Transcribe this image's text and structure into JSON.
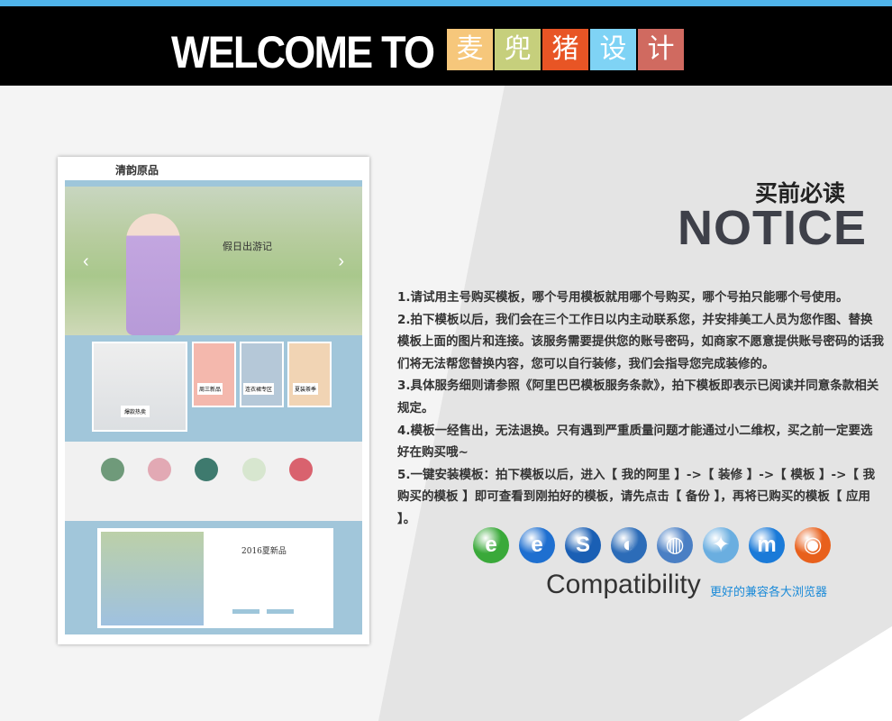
{
  "header": {
    "welcome": "WELCOME TO",
    "brand_tiles": [
      {
        "char": "麦",
        "color": "#f6c77b"
      },
      {
        "char": "兜",
        "color": "#c6cf7c"
      },
      {
        "char": "猪",
        "color": "#e85525"
      },
      {
        "char": "设",
        "color": "#7fd3f5"
      },
      {
        "char": "计",
        "color": "#d06a60"
      }
    ]
  },
  "accent_color": "#4fb3ea",
  "mockup": {
    "brand": "清韵原品",
    "hero_title": "假日出游记",
    "tiles": [
      "周三新品",
      "连衣裙专区",
      "夏装茶季",
      "爆款热卖"
    ],
    "promo_title": "2016夏新品"
  },
  "notice": {
    "title_cn": "买前必读",
    "title_en": "NOTICE",
    "rules": [
      "1.请试用主号购买模板，哪个号用模板就用哪个号购买，哪个号拍只能哪个号使用。",
      "2.拍下模板以后，我们会在三个工作日以内主动联系您，并安排美工人员为您作图、替换模板上面的图片和连接。该服务需要提供您的账号密码，如商家不愿意提供账号密码的话我们将无法帮您替换内容，您可以自行装修，我们会指导您完成装修的。",
      "3.具体服务细则请参照《阿里巴巴模板服务条款》，拍下模板即表示已阅读并同意条款相关规定。",
      "4.模板一经售出，无法退换。只有遇到严重质量问题才能通过小二维权，买之前一定要选好在购买哦~",
      "5.一键安装模板：拍下模板以后，进入【 我的阿里 】->【 装修 】->【 模板 】->【 我购买的模板 】即可查看到刚拍好的模板，请先点击【 备份 】，再将已购买的模板【 应用 】。"
    ]
  },
  "compatibility": {
    "title": "Compatibility",
    "subtitle": "更好的兼容各大浏览器",
    "browsers": [
      {
        "icon": "ie-green-icon",
        "glyph": "e",
        "color": "#3aa93a"
      },
      {
        "icon": "internet-explorer-icon",
        "glyph": "e",
        "color": "#1e6fd0"
      },
      {
        "icon": "sogou-browser-icon",
        "glyph": "S",
        "color": "#1a5fb4"
      },
      {
        "icon": "browser-globe-orange-icon",
        "glyph": "◐",
        "color": "#2c6cb8"
      },
      {
        "icon": "globe-icon",
        "glyph": "◍",
        "color": "#4a7fc4"
      },
      {
        "icon": "safari-icon",
        "glyph": "✦",
        "color": "#6aaee0"
      },
      {
        "icon": "maxthon-icon",
        "glyph": "m",
        "color": "#1a7ad8"
      },
      {
        "icon": "firefox-icon",
        "glyph": "◉",
        "color": "#e8601c"
      }
    ]
  }
}
